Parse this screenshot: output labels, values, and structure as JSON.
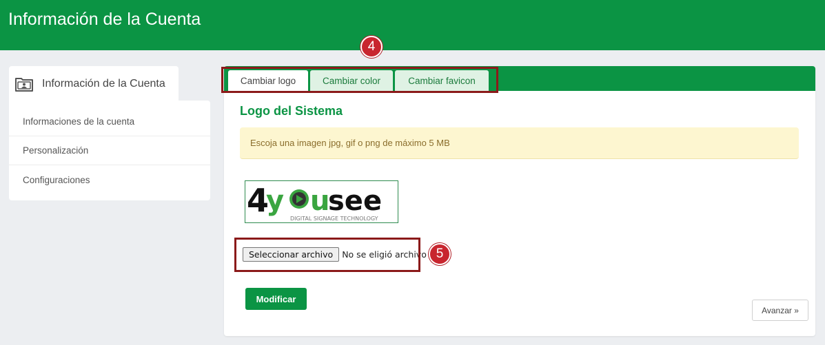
{
  "header": {
    "title": "Información de la Cuenta"
  },
  "sidebar": {
    "tab_label": "Información de la Cuenta",
    "tab_icon": "folder-user-icon",
    "items": [
      {
        "label": "Informaciones de la cuenta"
      },
      {
        "label": "Personalización"
      },
      {
        "label": "Configuraciones"
      }
    ]
  },
  "main": {
    "tabs": [
      {
        "label": "Cambiar logo",
        "active": true
      },
      {
        "label": "Cambiar color",
        "active": false
      },
      {
        "label": "Cambiar favicon",
        "active": false
      }
    ],
    "section_title": "Logo del Sistema",
    "alert_text": "Escoja una imagen jpg, gif o png de máximo 5 MB",
    "logo": {
      "brand_text": "4yousee",
      "tagline": "DIGITAL SIGNAGE TECHNOLOGY"
    },
    "file_input": {
      "button_label": "Seleccionar archivo",
      "status": "No se eligió archivo"
    },
    "submit_label": "Modificar",
    "next_label": "Avanzar »"
  },
  "annotations": {
    "badge_4": "4",
    "badge_5": "5"
  },
  "colors": {
    "brand_green": "#0b9444",
    "alert_bg": "#fdf6d0",
    "annotation_red": "#8b1a1a",
    "badge_red": "#c8262f"
  }
}
